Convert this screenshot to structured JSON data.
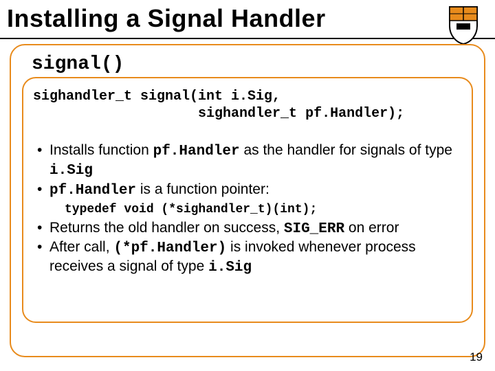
{
  "title": "Installing a Signal Handler",
  "section_heading": "signal()",
  "prototype_line1": "sighandler_t signal(int i.Sig,",
  "prototype_line2": "                    sighandler_t pf.Handler);",
  "bullets": {
    "b1_pre": "Installs function ",
    "b1_code1": "pf.Handler",
    "b1_mid": " as the handler for signals of type ",
    "b1_code2": "i.Sig",
    "b2_code": "pf.Handler",
    "b2_post": " is a function pointer:",
    "typedef": "typedef void (*sighandler_t)(int);",
    "b3_pre": "Returns the old handler on success, ",
    "b3_code": "SIG_ERR",
    "b3_post": " on error",
    "b4_pre": "After call, ",
    "b4_code": "(*pf.Handler)",
    "b4_mid": " is invoked whenever process receives a signal of type ",
    "b4_code2": "i.Sig"
  },
  "page_number": "19",
  "colors": {
    "frame": "#e88b1c"
  }
}
